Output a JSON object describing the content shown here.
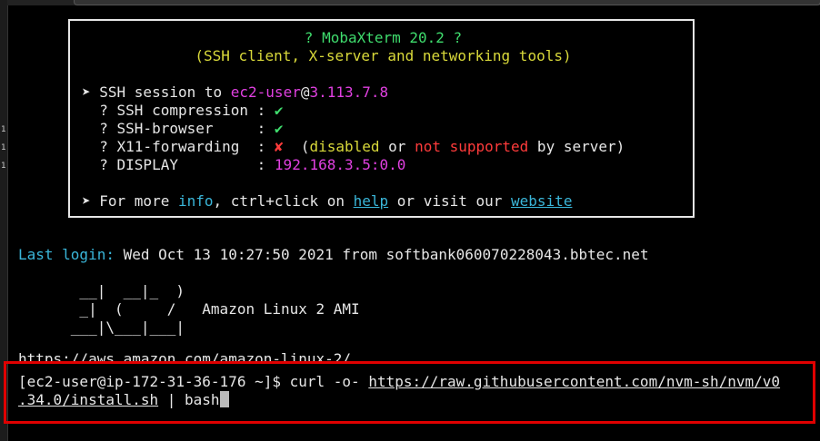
{
  "gutter": [
    "1",
    "1",
    "1"
  ],
  "banner": {
    "title": "? MobaXterm 20.2 ?",
    "subtitle": "(SSH client, X-server and networking tools)",
    "session_prefix": "➤ SSH session to ",
    "session_user": "ec2-user",
    "session_at": "@",
    "session_host": "3.113.7.8",
    "rows": [
      {
        "label": "  ? SSH compression : ",
        "mark": "✔"
      },
      {
        "label": "  ? SSH-browser     : ",
        "mark": "✔"
      }
    ],
    "x11_label": "  ? X11-forwarding  : ",
    "x11_mark": "✘",
    "x11_open": "  (",
    "x11_disabled": "disabled",
    "x11_or": " or ",
    "x11_not_supported": "not supported",
    "x11_tail": " by server)",
    "display_label": "  ? DISPLAY         : ",
    "display_value": "192.168.3.5:0.0",
    "more_prefix": "➤ For more ",
    "more_info": "info",
    "more_mid": ", ctrl+click on ",
    "more_help": "help",
    "more_or": " or visit our ",
    "more_website": "website"
  },
  "last_login": {
    "label": "Last login:",
    "text": " Wed Oct 13 10:27:50 2021 from softbank060070228043.bbtec.net"
  },
  "ascii_art": [
    "       __|  __|_  )",
    "       _|  (     /   Amazon Linux 2 AMI",
    "      ___|\\___|___|"
  ],
  "url_line": "https://aws.amazon.com/amazon-linux-2/",
  "command": {
    "prompt": "[ec2-user@ip-172-31-36-176 ~]$ curl -o- ",
    "url_part1": "https://raw.githubusercontent.com/nvm-sh/nvm/v0",
    "url_part2": ".34.0/install.sh",
    "tail": " | bash"
  }
}
